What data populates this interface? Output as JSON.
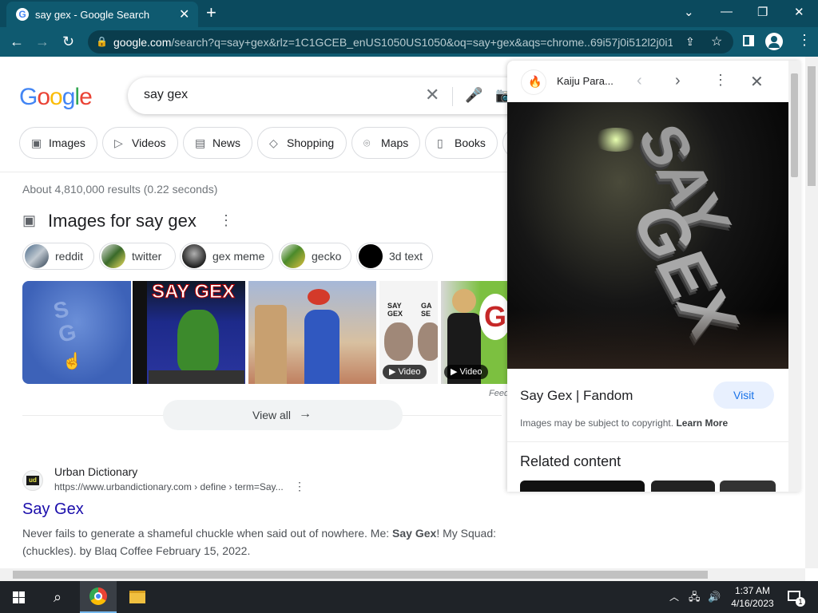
{
  "browser": {
    "tab_title": "say gex - Google Search",
    "url_host": "google.com",
    "url_path": "/search?q=say+gex&rlz=1C1GCEB_enUS1050US1050&oq=say+gex&aqs=chrome..69i57j0i512l2j0i1..."
  },
  "search": {
    "query": "say gex",
    "filters": [
      "Images",
      "Videos",
      "News",
      "Shopping",
      "Maps",
      "Books"
    ],
    "stats": "About 4,810,000 results (0.22 seconds)"
  },
  "images_section": {
    "heading": "Images for say gex",
    "related_chips": [
      "reddit",
      "twitter",
      "gex meme",
      "gecko",
      "3d text"
    ],
    "video_badge": "Video",
    "feedback": "Feedback",
    "view_all": "View all"
  },
  "result": {
    "site_name": "Urban Dictionary",
    "url": "https://www.urbandictionary.com › define › term=Say...",
    "title": "Say Gex",
    "snippet_1": "Never fails to generate a shameful chuckle when said out of nowhere. Me: ",
    "snippet_bold_1": "Say Gex",
    "snippet_2": "! My Squad: (chuckles). by Blaq Coffee February 15, 2022."
  },
  "panel": {
    "source_name": "Kaiju Para...",
    "title": "Say Gex | Fandom",
    "visit_label": "Visit",
    "copyright_text": "Images may be subject to copyright.",
    "learn_more": "Learn More",
    "related_heading": "Related content"
  },
  "taskbar": {
    "time": "1:37 AM",
    "date": "4/16/2023",
    "notification_count": "1"
  }
}
